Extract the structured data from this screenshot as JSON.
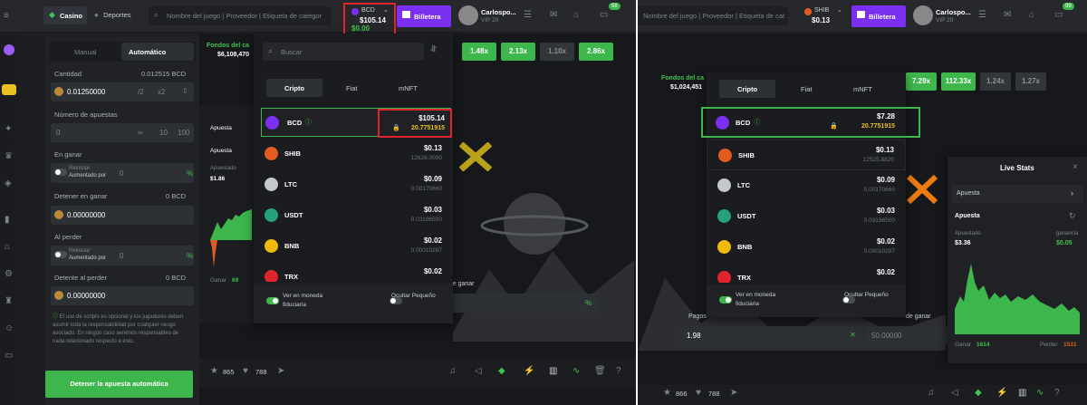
{
  "left": {
    "nav": {
      "casino": "Casino",
      "deportes": "Deportes",
      "search_placeholder": "Nombre del juego | Proveedor | Etiqueta de categor"
    },
    "balance": {
      "currency": "BCD",
      "amount": "$105.14",
      "sub": "$0.00"
    },
    "wallet_label": "Billetera",
    "user": {
      "name": "Carlospo...",
      "vip": "VIP 20",
      "notif": "56"
    },
    "bet_tabs": [
      "Manual",
      "Automático"
    ],
    "cantidad_label": "Cantidad",
    "cantidad_value": "0.012515 BCD",
    "cantidad_input": "0.01250000",
    "halve": "/2",
    "double": "x2",
    "num_bets_label": "Número de apuestas",
    "num_bets_value": "0",
    "num_bets_opts": [
      "∞",
      "10",
      "100"
    ],
    "on_win_label": "En ganar",
    "reset": "Reiniciar",
    "increase": "Aumentado por",
    "on_win_value": "0",
    "pct": "%",
    "stop_win_label": "Detener en ganar",
    "stop_win_unit": "0 BCD",
    "stop_win_value": "0.00000000",
    "on_loss_label": "Al perder",
    "on_loss_value": "0",
    "stop_loss_label": "Detente al perder",
    "stop_loss_unit": "0 BCD",
    "stop_loss_value": "0.00000000",
    "disclaimer": "El uso de scripts es opcional y los jugadores deben asumir toda la responsabilidad por cualquier riesgo asociado. En ningún caso seremos responsables de nada relacionado respecto a esto.",
    "stop_auto": "Detener la apuesta automática",
    "fondos_label": "Fondos del ca",
    "fondos_value": "$6,108,470",
    "multipliers": [
      "1.48x",
      "2.13x",
      "1.10x",
      "2.86x"
    ],
    "apuesta": "Apuesta",
    "apuestado": "Apuestado",
    "apuestado_val": "$1.86",
    "ganar": "Ganar",
    "ganar_val": "69",
    "likes": "865",
    "hearts": "788",
    "de_ganar": "d de ganar",
    "dropdown": {
      "search_placeholder": "Buscar",
      "tabs": [
        "Cripto",
        "Fiat",
        "mNFT"
      ],
      "coins": [
        {
          "name": "BCD",
          "value": "$105.14",
          "amount": "20.7751915"
        },
        {
          "name": "SHIB",
          "value": "$0.13",
          "amount": "12626.0000"
        },
        {
          "name": "LTC",
          "value": "$0.09",
          "amount": "0.00170660"
        },
        {
          "name": "USDT",
          "value": "$0.03",
          "amount": "0.03196500"
        },
        {
          "name": "BNB",
          "value": "$0.02",
          "amount": "0.00010287"
        },
        {
          "name": "TRX",
          "value": "$0.02",
          "amount": "0.20000000"
        }
      ],
      "fiat_toggle": "Ver en moneda fiduciaria",
      "hide_small": "Ocultar Pequeño"
    }
  },
  "right": {
    "search_placeholder": "Nombre del juego | Proveedor | Etiqueta de categor",
    "balance": {
      "currency": "SHIB",
      "amount": "$0.13"
    },
    "wallet_label": "Billetera",
    "user": {
      "name": "Carlospo...",
      "vip": "VIP 20",
      "notif": "99"
    },
    "fondos_label": "Fondos del ca",
    "fondos_value": "$1,024,451",
    "multipliers": [
      "7.29x",
      "112.33x",
      "1.24x",
      "1.27x"
    ],
    "dropdown": {
      "tabs": [
        "Cripto",
        "Fiat",
        "mNFT"
      ],
      "coins": [
        {
          "name": "BCD",
          "value": "$7.28",
          "amount": "20.7751915"
        },
        {
          "name": "SHIB",
          "value": "$0.13",
          "amount": "12525.8820"
        },
        {
          "name": "LTC",
          "value": "$0.09",
          "amount": "0.00170660"
        },
        {
          "name": "USDT",
          "value": "$0.03",
          "amount": "0.03196500"
        },
        {
          "name": "BNB",
          "value": "$0.02",
          "amount": "0.00010287"
        },
        {
          "name": "TRX",
          "value": "$0.02",
          "amount": "0.20000000"
        }
      ],
      "fiat_toggle": "Ver en moneda fiduciaria",
      "hide_small": "Ocultar Pequeño"
    },
    "pagos_label": "Pagos",
    "de_ganar": "de ganar",
    "pagos_value": "1.98",
    "bet_value": "50.00000",
    "live": {
      "title": "Live Stats",
      "apuesta": "Apuesta",
      "apuesta2": "Apuesta",
      "apuestado": "Apuestado",
      "ganancia": "ganancia",
      "apuestado_val": "$3.36",
      "ganancia_val": "$0.05",
      "ganar": "Ganar",
      "ganar_val": "1614",
      "perder": "Perder",
      "perder_val": "1531"
    },
    "likes": "866",
    "hearts": "788"
  },
  "colors": {
    "green": "#3db64c",
    "purple": "#7b2ff0",
    "red_box": "#e0242e",
    "green_box": "#3db64c",
    "x_olive": "#b9a11b",
    "x_orange": "#f07a12"
  }
}
